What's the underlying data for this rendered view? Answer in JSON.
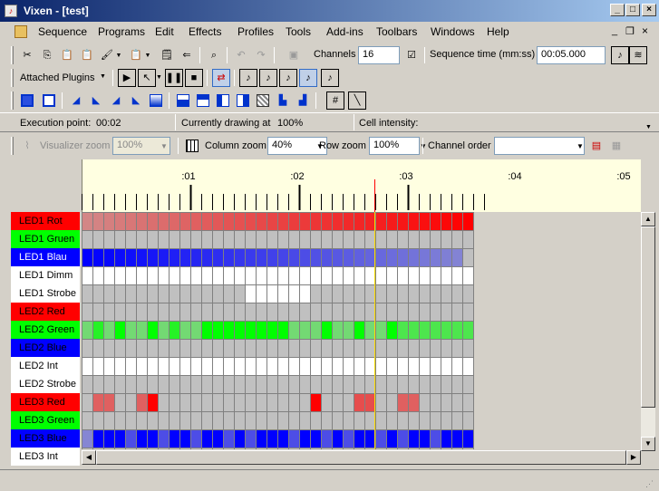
{
  "window": {
    "app_icon": "vixen-app-icon",
    "title": "Vixen - [test]",
    "caption_buttons": [
      "minimize-icon",
      "maximize-icon",
      "close-icon"
    ]
  },
  "menu": {
    "items": [
      "Sequence",
      "Programs",
      "Edit",
      "Effects",
      "Profiles",
      "Tools",
      "Add-ins",
      "Toolbars",
      "Windows",
      "Help"
    ],
    "mdi_buttons": [
      "mdi-minimize-icon",
      "mdi-restore-icon",
      "mdi-close-icon"
    ]
  },
  "toolbar1": {
    "icons": [
      "cut-icon",
      "copy-icon",
      "paste-icon",
      "paste-special-icon",
      "paint-icon",
      "paste-dropdown-icon",
      "clipboard-icon",
      "undo-export-icon",
      "find-icon",
      "undo-icon",
      "redo-icon",
      "save-icon"
    ],
    "channels_label": "Channels",
    "channels_value": "16",
    "sequence_time_label": "Sequence time (mm:ss)",
    "sequence_time_value": "00:05.000"
  },
  "toolbar2": {
    "attached_plugins_label": "Attached Plugins",
    "icons": [
      "play-icon",
      "play-from-point-icon",
      "pause-icon",
      "stop-icon",
      "toggle-playback-icon",
      "music-note-1-icon",
      "music-note-2-icon",
      "music-note-3-icon",
      "music-note-4-icon",
      "music-note-5-icon"
    ]
  },
  "toolbar3": {
    "icons": [
      "on-icon",
      "off-icon",
      "ramp-up-icon",
      "ramp-down-icon",
      "partial-ramp-up-icon",
      "partial-ramp-down-icon",
      "fade-icon",
      "shimmer-icon",
      "sparkle-icon",
      "random-icon",
      "intensity-icon",
      "mask-icon",
      "spectrum-icon",
      "levels-icon",
      "hash-icon",
      "draw-icon"
    ]
  },
  "status": {
    "execution_point_label": "Execution point:",
    "execution_point_value": "00:02",
    "drawing_label": "Currently drawing at",
    "drawing_value": "100%",
    "cell_intensity_label": "Cell intensity:",
    "cell_intensity_value": ""
  },
  "zoom": {
    "visualizer_label": "Visualizer zoom",
    "visualizer_value": "100%",
    "column_label": "Column zoom",
    "column_value": "40%",
    "row_label": "Row zoom",
    "row_value": "100%",
    "channel_order_label": "Channel order",
    "channel_order_value": ""
  },
  "timeline": {
    "time_labels": [
      ":01",
      ":02",
      ":03",
      ":04",
      ":05"
    ],
    "marker_color": "#ff0000",
    "cursor_color": "#ffdd00"
  },
  "channels": [
    {
      "name": "LED1 Rot",
      "color": "#ff0000",
      "label_color": "#000000",
      "cells": [
        30,
        32,
        34,
        36,
        38,
        40,
        42,
        44,
        46,
        48,
        50,
        52,
        54,
        56,
        58,
        60,
        62,
        64,
        66,
        68,
        70,
        72,
        74,
        76,
        78,
        80,
        82,
        84,
        86,
        88,
        90,
        92,
        94,
        96,
        98,
        100
      ]
    },
    {
      "name": "LED1 Gruen",
      "color": "#00ff00",
      "label_color": "#000000",
      "cells": [
        0,
        0,
        0,
        0,
        0,
        0,
        0,
        0,
        0,
        0,
        0,
        0,
        0,
        0,
        0,
        0,
        0,
        0,
        0,
        0,
        0,
        0,
        0,
        0,
        0,
        0,
        0,
        0,
        0,
        0,
        0,
        0,
        0,
        0,
        0,
        0
      ]
    },
    {
      "name": "LED1 Blau",
      "color": "#0000ff",
      "label_color": "#ffffff",
      "cells": [
        100,
        98,
        96,
        94,
        92,
        90,
        88,
        86,
        84,
        82,
        80,
        78,
        76,
        74,
        72,
        70,
        68,
        66,
        64,
        62,
        60,
        58,
        56,
        54,
        52,
        50,
        48,
        46,
        44,
        42,
        40,
        38,
        36,
        34,
        32,
        0
      ]
    },
    {
      "name": "LED1 Dimm",
      "color": "#ffffff",
      "label_color": "#000000",
      "cells": [
        100,
        100,
        100,
        100,
        100,
        100,
        100,
        100,
        100,
        100,
        100,
        100,
        100,
        100,
        100,
        100,
        100,
        100,
        100,
        100,
        100,
        100,
        100,
        100,
        100,
        100,
        100,
        100,
        100,
        100,
        100,
        100,
        100,
        100,
        100,
        100
      ]
    },
    {
      "name": "LED1 Strobe",
      "color": "#ffffff",
      "label_color": "#000000",
      "cells": [
        0,
        0,
        0,
        0,
        0,
        0,
        0,
        0,
        0,
        0,
        0,
        0,
        0,
        0,
        0,
        100,
        100,
        100,
        100,
        100,
        100,
        0,
        0,
        0,
        0,
        0,
        0,
        0,
        0,
        0,
        0,
        0,
        0,
        0,
        0,
        0
      ]
    },
    {
      "name": "LED2 Red",
      "color": "#ff0000",
      "label_color": "#000000",
      "cells": [
        0,
        0,
        0,
        0,
        0,
        0,
        0,
        0,
        0,
        0,
        0,
        0,
        0,
        0,
        0,
        0,
        0,
        0,
        0,
        0,
        0,
        0,
        0,
        0,
        0,
        0,
        0,
        0,
        0,
        0,
        0,
        0,
        0,
        0,
        0,
        0
      ]
    },
    {
      "name": "LED2 Green",
      "color": "#00ff00",
      "label_color": "#000000",
      "cells": [
        40,
        80,
        40,
        100,
        40,
        40,
        100,
        40,
        80,
        40,
        40,
        100,
        100,
        100,
        100,
        100,
        100,
        100,
        100,
        40,
        40,
        40,
        100,
        40,
        40,
        100,
        40,
        40,
        100,
        60,
        60,
        60,
        60,
        60,
        60,
        60
      ]
    },
    {
      "name": "LED2 Blue",
      "color": "#0000ff",
      "label_color": "#000000",
      "cells": [
        0,
        0,
        0,
        0,
        0,
        0,
        0,
        0,
        0,
        0,
        0,
        0,
        0,
        0,
        0,
        0,
        0,
        0,
        0,
        0,
        0,
        0,
        0,
        0,
        0,
        0,
        0,
        0,
        0,
        0,
        0,
        0,
        0,
        0,
        0,
        0
      ]
    },
    {
      "name": "LED2 Int",
      "color": "#ffffff",
      "label_color": "#000000",
      "cells": [
        100,
        100,
        100,
        100,
        100,
        100,
        100,
        100,
        100,
        100,
        100,
        100,
        100,
        100,
        100,
        100,
        100,
        100,
        100,
        100,
        100,
        100,
        100,
        100,
        100,
        100,
        100,
        100,
        100,
        100,
        100,
        100,
        100,
        100,
        100,
        100
      ]
    },
    {
      "name": "LED2 Strobe",
      "color": "#ffffff",
      "label_color": "#000000",
      "cells": [
        0,
        0,
        0,
        0,
        0,
        0,
        0,
        0,
        0,
        0,
        0,
        0,
        0,
        0,
        0,
        0,
        0,
        0,
        0,
        0,
        0,
        0,
        0,
        0,
        0,
        0,
        0,
        0,
        0,
        0,
        0,
        0,
        0,
        0,
        0,
        0
      ]
    },
    {
      "name": "LED3 Red",
      "color": "#ff0000",
      "label_color": "#000000",
      "cells": [
        0,
        50,
        50,
        0,
        0,
        50,
        100,
        0,
        0,
        0,
        0,
        0,
        0,
        0,
        0,
        0,
        0,
        0,
        0,
        0,
        0,
        100,
        0,
        0,
        0,
        60,
        60,
        0,
        0,
        50,
        50,
        0,
        0,
        0,
        0,
        0
      ]
    },
    {
      "name": "LED3 Green",
      "color": "#00ff00",
      "label_color": "#000000",
      "cells": [
        0,
        0,
        0,
        0,
        0,
        0,
        0,
        0,
        0,
        0,
        0,
        0,
        0,
        0,
        0,
        0,
        0,
        0,
        0,
        0,
        0,
        0,
        0,
        0,
        0,
        0,
        0,
        0,
        0,
        0,
        0,
        0,
        0,
        0,
        0,
        0
      ]
    },
    {
      "name": "LED3 Blue",
      "color": "#0000ff",
      "label_color": "#000000",
      "cells": [
        30,
        100,
        100,
        100,
        60,
        100,
        100,
        60,
        100,
        100,
        60,
        100,
        100,
        60,
        100,
        60,
        100,
        100,
        100,
        60,
        100,
        100,
        60,
        100,
        60,
        100,
        100,
        60,
        100,
        60,
        100,
        100,
        60,
        100,
        100,
        100
      ]
    },
    {
      "name": "LED3 Int",
      "color": "#ffffff",
      "label_color": "#000000",
      "cells": [
        0,
        0,
        0,
        0,
        0,
        0,
        0,
        0,
        0,
        0,
        0,
        0,
        0,
        0,
        0,
        0,
        0,
        0,
        0,
        0,
        0,
        0,
        0,
        0,
        0,
        0,
        0,
        0,
        0,
        0,
        0,
        0,
        0,
        0,
        0,
        0
      ]
    }
  ],
  "grid": {
    "empty_cell_color": "#c0c0c0",
    "grid_line_color": "#808080",
    "ruler_background": "#ffffe1"
  }
}
